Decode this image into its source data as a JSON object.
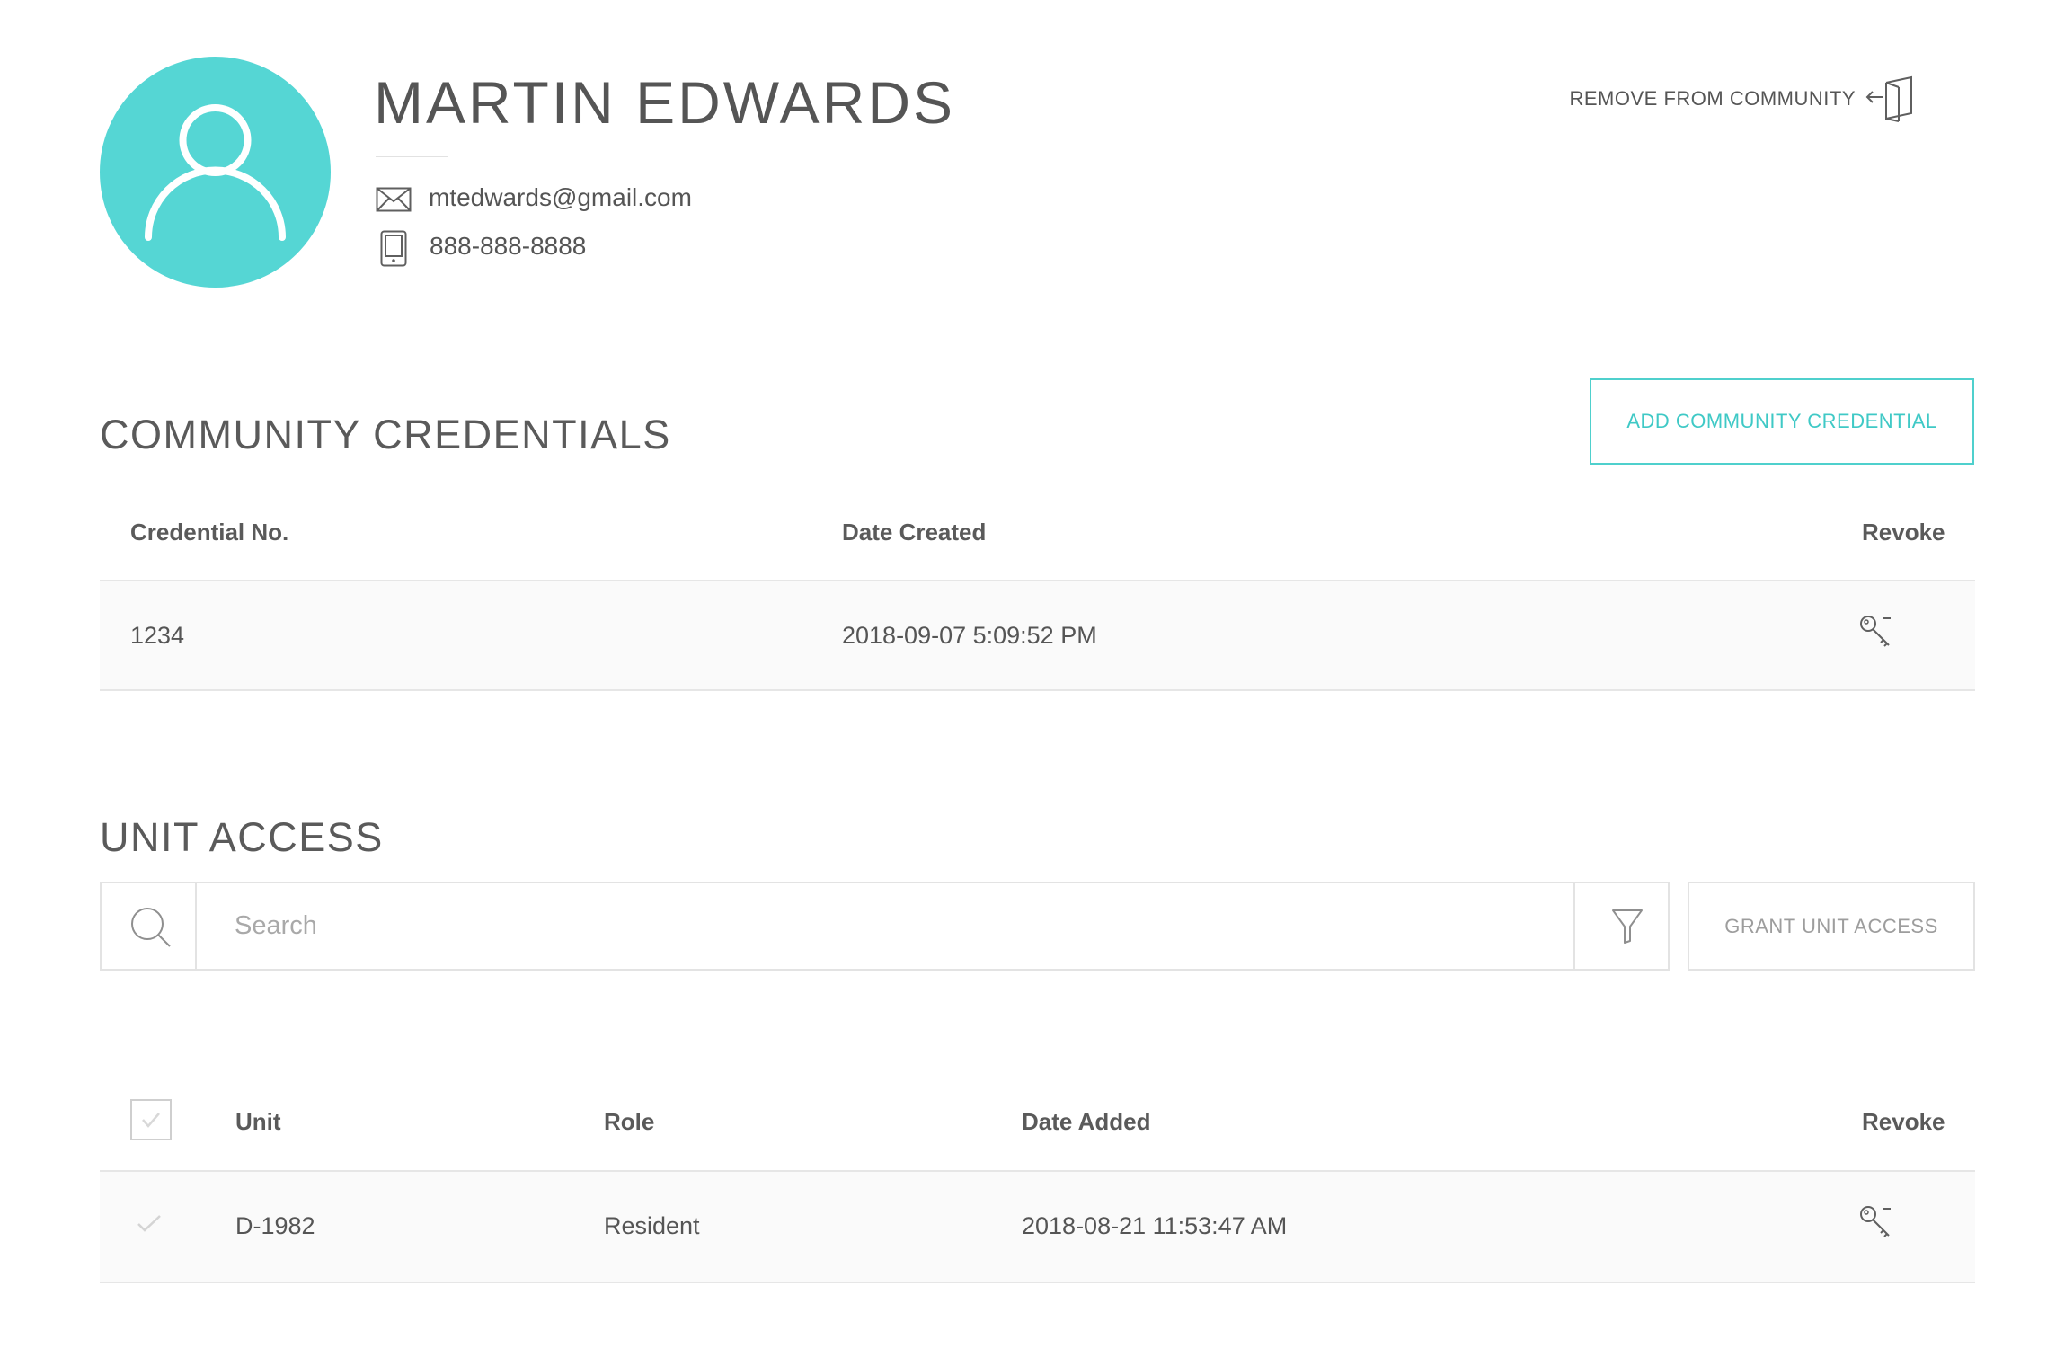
{
  "profile": {
    "name": "MARTIN EDWARDS",
    "email": "mtedwards@gmail.com",
    "phone": "888-888-8888",
    "avatar_icon": "user-icon",
    "avatar_color": "#55d6d4"
  },
  "header_actions": {
    "remove_label": "REMOVE FROM COMMUNITY",
    "remove_icon": "exit-door-icon"
  },
  "credentials": {
    "title": "COMMUNITY CREDENTIALS",
    "add_button": "ADD COMMUNITY CREDENTIAL",
    "columns": [
      "Credential No.",
      "Date Created",
      "Revoke"
    ],
    "rows": [
      {
        "credential_no": "1234",
        "date_created": "2018-09-07 5:09:52 PM",
        "revoke_icon": "key-icon"
      }
    ]
  },
  "unit_access": {
    "title": "UNIT ACCESS",
    "search_placeholder": "Search",
    "grant_button": "GRANT UNIT ACCESS",
    "columns": [
      "Unit",
      "Role",
      "Date Added",
      "Revoke"
    ],
    "rows": [
      {
        "unit": "D-1982",
        "role": "Resident",
        "date_added": "2018-08-21 11:53:47 AM",
        "revoke_icon": "key-icon"
      }
    ]
  },
  "colors": {
    "accent": "#4fd0cd",
    "text": "#555555",
    "border": "#e3e3e3"
  }
}
